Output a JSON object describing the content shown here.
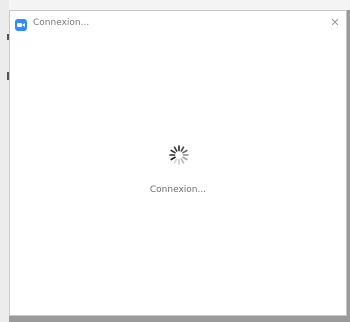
{
  "window": {
    "title": "Connexion...",
    "close_glyph": "✕"
  },
  "main": {
    "status": "Connexion..."
  },
  "icons": {
    "app": "video-camera-icon",
    "spinner": "loading-spinner-icon",
    "close": "close-icon"
  },
  "colors": {
    "app_accent": "#2d8cff",
    "title_text": "#7a7a7a",
    "status_text": "#6e6e6e"
  }
}
